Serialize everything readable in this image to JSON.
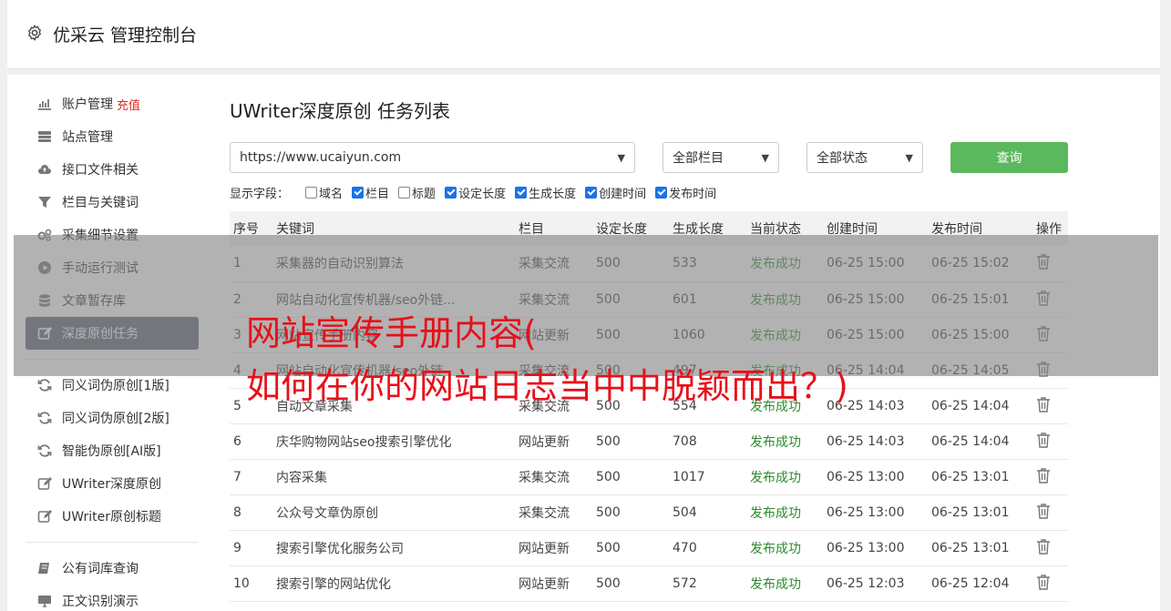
{
  "app": {
    "title": "优采云 管理控制台"
  },
  "sidebar": {
    "groups": [
      [
        {
          "label": "账户管理",
          "tag": "充值",
          "icon": "bar-chart-icon"
        },
        {
          "label": "站点管理",
          "icon": "server-icon"
        },
        {
          "label": "接口文件相关",
          "icon": "cloud-upload-icon"
        },
        {
          "label": "栏目与关键词",
          "icon": "filter-icon"
        },
        {
          "label": "采集细节设置",
          "icon": "gears-icon"
        },
        {
          "label": "手动运行测试",
          "icon": "play-circle-icon"
        },
        {
          "label": "文章暂存库",
          "icon": "database-icon"
        },
        {
          "label": "深度原创任务",
          "icon": "edit-icon",
          "active": true
        }
      ],
      [
        {
          "label": "同义词伪原创[1版]",
          "icon": "refresh-icon"
        },
        {
          "label": "同义词伪原创[2版]",
          "icon": "refresh-icon"
        },
        {
          "label": "智能伪原创[AI版]",
          "icon": "refresh-icon"
        },
        {
          "label": "UWriter深度原创",
          "icon": "edit-icon"
        },
        {
          "label": "UWriter原创标题",
          "icon": "edit-icon"
        }
      ],
      [
        {
          "label": "公有词库查询",
          "icon": "book-icon"
        },
        {
          "label": "正文识别演示",
          "icon": "monitor-icon"
        }
      ]
    ]
  },
  "main": {
    "title": "UWriter深度原创 任务列表",
    "site_select": "https://www.ucaiyun.com",
    "column_select": "全部栏目",
    "status_select": "全部状态",
    "query_label": "查询",
    "fields_label": "显示字段：",
    "fields": [
      {
        "label": "域名",
        "checked": false
      },
      {
        "label": "栏目",
        "checked": true
      },
      {
        "label": "标题",
        "checked": false
      },
      {
        "label": "设定长度",
        "checked": true
      },
      {
        "label": "生成长度",
        "checked": true
      },
      {
        "label": "创建时间",
        "checked": true
      },
      {
        "label": "发布时间",
        "checked": true
      }
    ],
    "columns": [
      "序号",
      "关键词",
      "栏目",
      "设定长度",
      "生成长度",
      "当前状态",
      "创建时间",
      "发布时间",
      "操作"
    ],
    "rows": [
      [
        "1",
        "采集器的自动识别算法",
        "采集交流",
        "500",
        "533",
        "发布成功",
        "06-25 15:00",
        "06-25 15:02"
      ],
      [
        "2",
        "网站自动化宣传机器/seo外链...",
        "采集交流",
        "500",
        "601",
        "发布成功",
        "06-25 15:00",
        "06-25 15:01"
      ],
      [
        "3",
        "网站宣传手册内容",
        "网站更新",
        "500",
        "1060",
        "发布成功",
        "06-25 15:00",
        "06-25 15:00"
      ],
      [
        "4",
        "网站自动化宣传机器/seo外链",
        "采集交流",
        "500",
        "497",
        "发布成功",
        "06-25 14:04",
        "06-25 14:05"
      ],
      [
        "5",
        "自动文章采集",
        "采集交流",
        "500",
        "554",
        "发布成功",
        "06-25 14:03",
        "06-25 14:04"
      ],
      [
        "6",
        "庆华购物网站seo搜索引擎优化",
        "网站更新",
        "500",
        "708",
        "发布成功",
        "06-25 14:03",
        "06-25 14:04"
      ],
      [
        "7",
        "内容采集",
        "采集交流",
        "500",
        "1017",
        "发布成功",
        "06-25 13:00",
        "06-25 13:01"
      ],
      [
        "8",
        "公众号文章伪原创",
        "采集交流",
        "500",
        "504",
        "发布成功",
        "06-25 13:00",
        "06-25 13:01"
      ],
      [
        "9",
        "搜索引擎优化服务公司",
        "网站更新",
        "500",
        "470",
        "发布成功",
        "06-25 13:00",
        "06-25 13:01"
      ],
      [
        "10",
        "搜索引擎的网站优化",
        "网站更新",
        "500",
        "572",
        "发布成功",
        "06-25 12:03",
        "06-25 12:04"
      ]
    ]
  },
  "overlay": {
    "line1": "网站宣传手册内容(",
    "line2": "如何在你的网站日志当中中脱颖而出？)"
  }
}
